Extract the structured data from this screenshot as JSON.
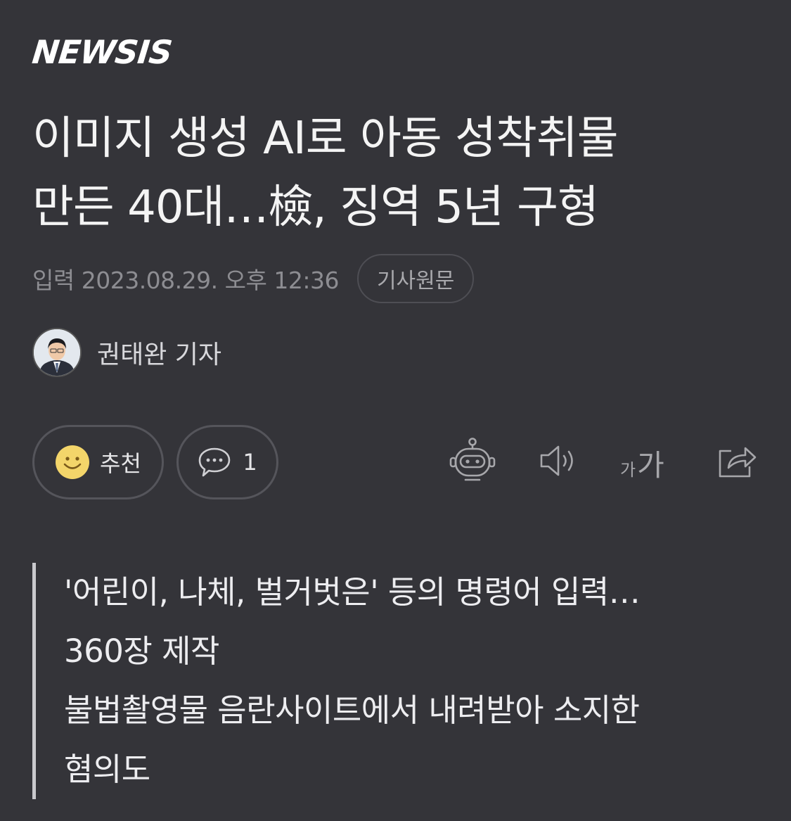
{
  "header": {
    "logo_text": "NEWSIS"
  },
  "article": {
    "headline_line1": "이미지 생성 AI로 아동 성착취물",
    "headline_line2": "만든 40대…檢, 징역 5년 구형",
    "date_text": "입력 2023.08.29. 오후 12:36",
    "original_button": "기사원문",
    "reporter": "권태완 기자"
  },
  "actions": {
    "recommend_label": "추천",
    "comment_count": "1",
    "font_small": "가",
    "font_big": "가"
  },
  "summary": {
    "lines": [
      "'어린이, 나체, 벌거벗은' 등의 명령어 입력…",
      "360장 제작",
      "불법촬영물 음란사이트에서 내려받아 소지한",
      "혐의도"
    ]
  },
  "icons": {
    "recommend": "smile-icon",
    "comment": "speech-bubble-icon",
    "summary_bot": "robot-icon",
    "tts": "speaker-icon",
    "font_size": "font-size-icon",
    "share": "share-icon"
  },
  "colors": {
    "background": "#343439",
    "text": "#f4f4f4",
    "muted": "#8d8d92",
    "border": "#55555b",
    "smile": "#f3d56a"
  }
}
